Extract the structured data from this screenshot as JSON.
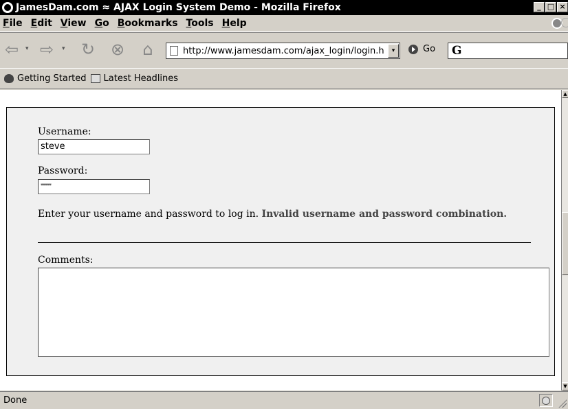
{
  "window": {
    "title": "JamesDam.com ≈ AJAX Login System Demo - Mozilla Firefox",
    "min_glyph": "_",
    "max_glyph": "□",
    "close_glyph": "×"
  },
  "menu": {
    "items": [
      {
        "mnemonic": "F",
        "rest": "ile"
      },
      {
        "mnemonic": "E",
        "rest": "dit"
      },
      {
        "mnemonic": "V",
        "rest": "iew"
      },
      {
        "mnemonic": "G",
        "rest": "o"
      },
      {
        "mnemonic": "B",
        "rest": "ookmarks"
      },
      {
        "mnemonic": "T",
        "rest": "ools"
      },
      {
        "mnemonic": "H",
        "rest": "elp"
      }
    ]
  },
  "navbar": {
    "back_glyph": "⇦",
    "forward_glyph": "⇨",
    "reload_glyph": "↻",
    "stop_glyph": "⊗",
    "home_glyph": "⌂",
    "dropdown_glyph": "▾",
    "url": "http://www.jamesdam.com/ajax_login/login.h",
    "go_label": "Go",
    "search_logo": "G"
  },
  "bookmarks": {
    "items": [
      {
        "label": "Getting Started",
        "icon": "getting-started-icon"
      },
      {
        "label": "Latest Headlines",
        "icon": "rss-feed-icon"
      }
    ]
  },
  "form": {
    "username_label": "Username:",
    "username_value": "steve",
    "password_label": "Password:",
    "password_value": "*****",
    "instructions": "Enter your username and password to log in.",
    "error": "Invalid username and password combination.",
    "comments_label": "Comments:"
  },
  "status": {
    "text": "Done"
  },
  "colors": {
    "chrome": "#d4d0c8",
    "titlebar": "#000000",
    "panel": "#f0f0f0",
    "error_text": "#444444"
  }
}
